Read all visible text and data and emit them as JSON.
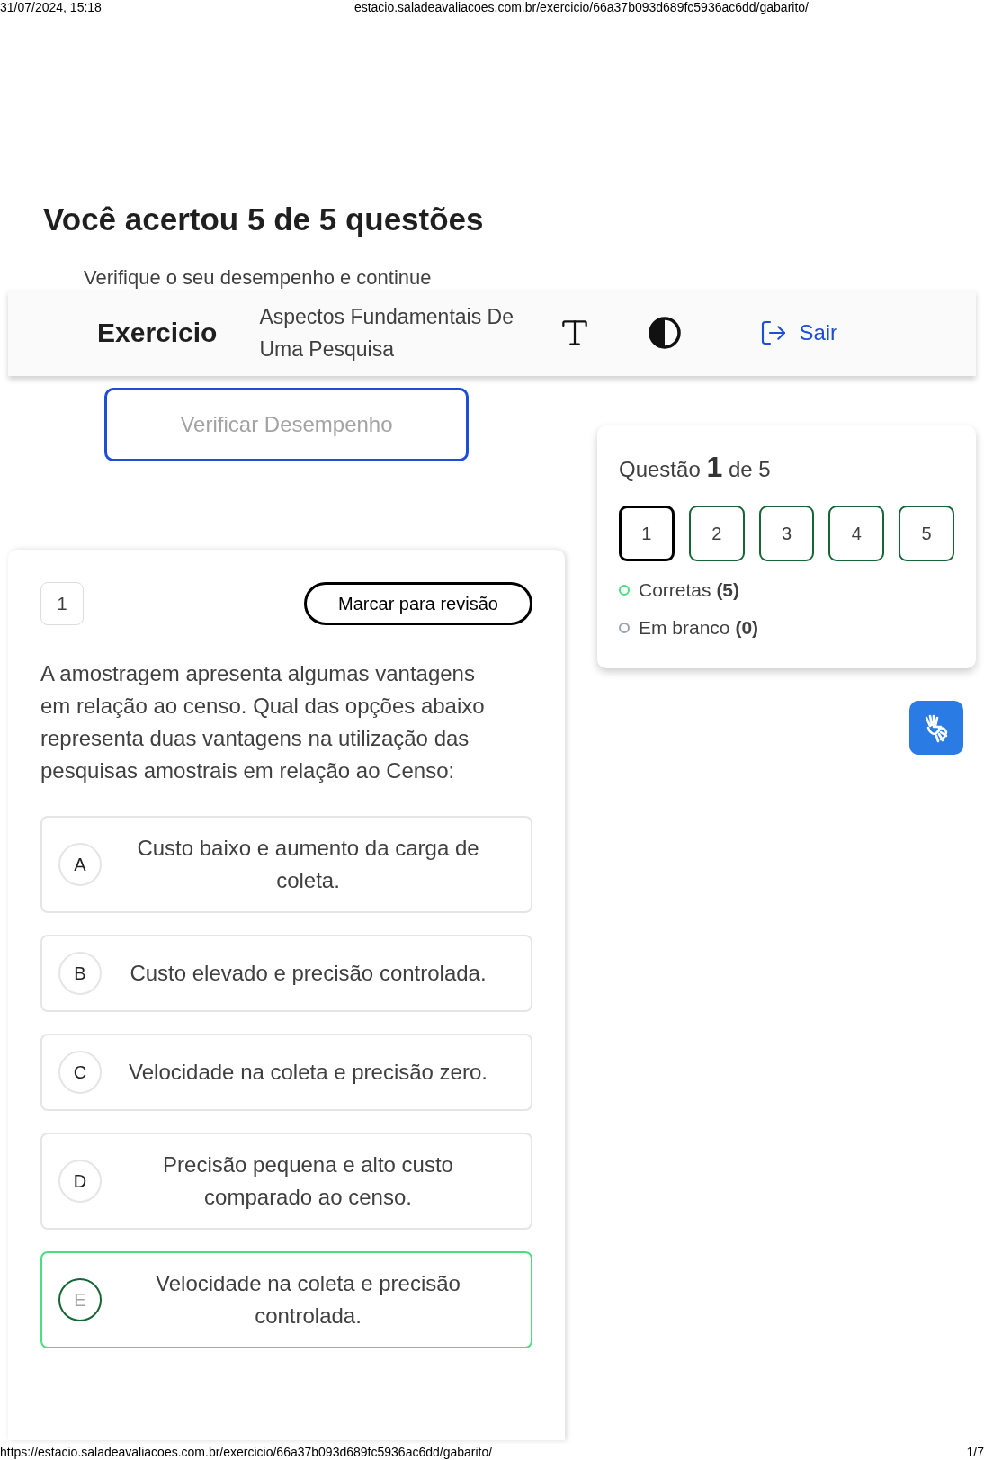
{
  "print_header": {
    "datetime": "31/07/2024, 15:18",
    "url": "estacio.saladeavaliacoes.com.br/exercicio/66a37b093d689fc5936ac6dd/gabarito/"
  },
  "result": {
    "title": "Você acertou 5 de 5 questões",
    "subtitle": "Verifique o seu desempenho e continue"
  },
  "topbar": {
    "brand": "Exercicio",
    "topic": "Aspectos Fundamentais De Uma Pesquisa",
    "exit": "Sair"
  },
  "check_button": "Verificar Desempenho",
  "question": {
    "number": "1",
    "review_button": "Marcar para revisão",
    "text": "A amostragem apresenta algumas vantagens em relação ao censo. Qual das opções abaixo representa duas vantagens na utilização das pesquisas amostrais em relação ao Censo:",
    "options": [
      {
        "letter": "A",
        "text": "Custo baixo e aumento da carga de coleta.",
        "correct": false
      },
      {
        "letter": "B",
        "text": "Custo elevado e precisão controlada.",
        "correct": false
      },
      {
        "letter": "C",
        "text": "Velocidade na coleta e precisão zero.",
        "correct": false
      },
      {
        "letter": "D",
        "text": "Precisão pequena e alto custo comparado ao censo.",
        "correct": false
      },
      {
        "letter": "E",
        "text": "Velocidade na coleta e precisão controlada.",
        "correct": true
      }
    ]
  },
  "navigator": {
    "label_before": "Questão",
    "current": "1",
    "label_after": "de 5",
    "questions": [
      {
        "label": "1",
        "selected": true
      },
      {
        "label": "2",
        "selected": false
      },
      {
        "label": "3",
        "selected": false
      },
      {
        "label": "4",
        "selected": false
      },
      {
        "label": "5",
        "selected": false
      }
    ],
    "legend": [
      {
        "label": "Corretas",
        "count": "(5)",
        "color": "#4ade80"
      },
      {
        "label": "Em branco",
        "count": "(0)",
        "color": "#9ca3af"
      }
    ]
  },
  "print_footer": {
    "url": "https://estacio.saladeavaliacoes.com.br/exercicio/66a37b093d689fc5936ac6dd/gabarito/",
    "page": "1/7"
  }
}
